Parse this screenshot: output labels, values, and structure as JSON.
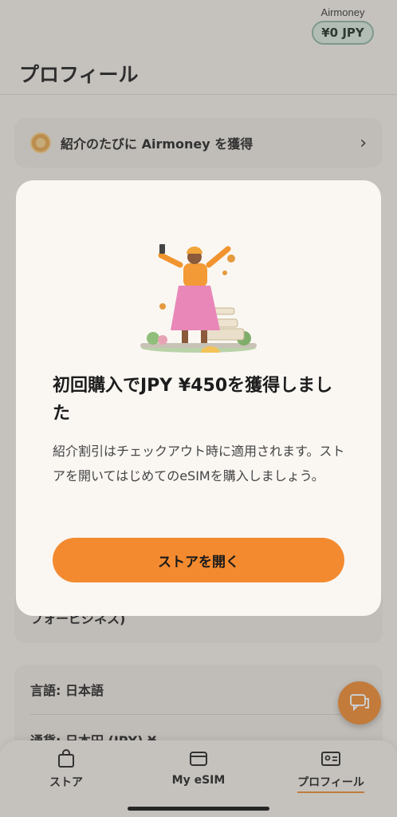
{
  "header": {
    "airmoney_label": "Airmoney",
    "airmoney_balance": "¥0 JPY",
    "title": "プロフィール"
  },
  "referral_card": {
    "label": "紹介のたびに Airmoney を獲得"
  },
  "hidden_card": {
    "text": "フォービジネス)"
  },
  "settings": {
    "language": "言語: 日本語",
    "currency": "通貨: 日本円 (JPY) ¥"
  },
  "modal": {
    "title": "初回購入でJPY ¥450を獲得しました",
    "body": "紹介割引はチェックアウト時に適用されます。ストアを開いてはじめてのeSIMを購入しましょう。",
    "cta": "ストアを開く"
  },
  "tabbar": {
    "tabs": [
      {
        "label": "ストア",
        "icon": "bag-icon"
      },
      {
        "label": "My eSIM",
        "icon": "sim-icon"
      },
      {
        "label": "プロフィール",
        "icon": "id-card-icon",
        "active": true
      }
    ]
  },
  "colors": {
    "accent": "#f48a2f",
    "background": "#f4f0ea",
    "badge_bg": "#d9e8de"
  }
}
